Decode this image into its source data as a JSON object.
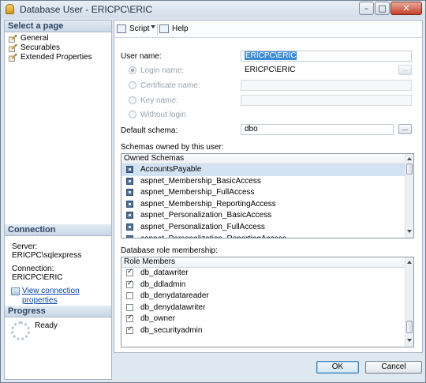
{
  "window": {
    "title": "Database User - ERICPC\\ERIC"
  },
  "title_controls": {
    "minimize": "–",
    "maximize": "□",
    "close": "✕"
  },
  "left": {
    "select_page_header": "Select a page",
    "pages": [
      {
        "label": "General",
        "icon": "wrench-icon"
      },
      {
        "label": "Securables",
        "icon": "wrench-icon"
      },
      {
        "label": "Extended Properties",
        "icon": "wrench-icon"
      }
    ],
    "connection_header": "Connection",
    "server_label": "Server:",
    "server_value": "ERICPC\\sqlexpress",
    "connection_label": "Connection:",
    "connection_value": "ERICPC\\ERIC",
    "view_connection_link": "View connection properties",
    "progress_header": "Progress",
    "progress_status": "Ready"
  },
  "toolbar": {
    "script_label": "Script",
    "help_label": "Help"
  },
  "form": {
    "user_name_label": "User name:",
    "user_name_value": "ERICPC\\ERIC",
    "login_name_label": "Login name:",
    "login_name_value": "ERICPC\\ERIC",
    "certificate_name_label": "Certificate name:",
    "key_name_label": "Key name:",
    "without_login_label": "Without login",
    "browse_label": "...",
    "default_schema_label": "Default schema:",
    "default_schema_value": "dbo",
    "schemas_owned_label": "Schemas owned by this user:",
    "role_membership_label": "Database role membership:"
  },
  "schemas": {
    "header": "Owned Schemas",
    "items": [
      {
        "name": "AccountsPayable",
        "checked": false,
        "selected": true
      },
      {
        "name": "aspnet_Membership_BasicAccess",
        "checked": false
      },
      {
        "name": "aspnet_Membership_FullAccess",
        "checked": false
      },
      {
        "name": "aspnet_Membership_ReportingAccess",
        "checked": false
      },
      {
        "name": "aspnet_Personalization_BasicAccess",
        "checked": false
      },
      {
        "name": "aspnet_Personalization_FullAccess",
        "checked": false
      },
      {
        "name": "aspnet_Personalization_ReportingAccess",
        "checked": false
      }
    ]
  },
  "roles": {
    "header": "Role Members",
    "items": [
      {
        "name": "db_datawriter",
        "checked": true
      },
      {
        "name": "db_ddladmin",
        "checked": true
      },
      {
        "name": "db_denydatareader",
        "checked": false
      },
      {
        "name": "db_denydatawriter",
        "checked": false
      },
      {
        "name": "db_owner",
        "checked": true
      },
      {
        "name": "db_securityadmin",
        "checked": true
      }
    ]
  },
  "buttons": {
    "ok": "OK",
    "cancel": "Cancel"
  },
  "colors": {
    "selection": "#3b8bd6",
    "row_highlight": "#d4e3f4",
    "link": "#0645ad"
  }
}
